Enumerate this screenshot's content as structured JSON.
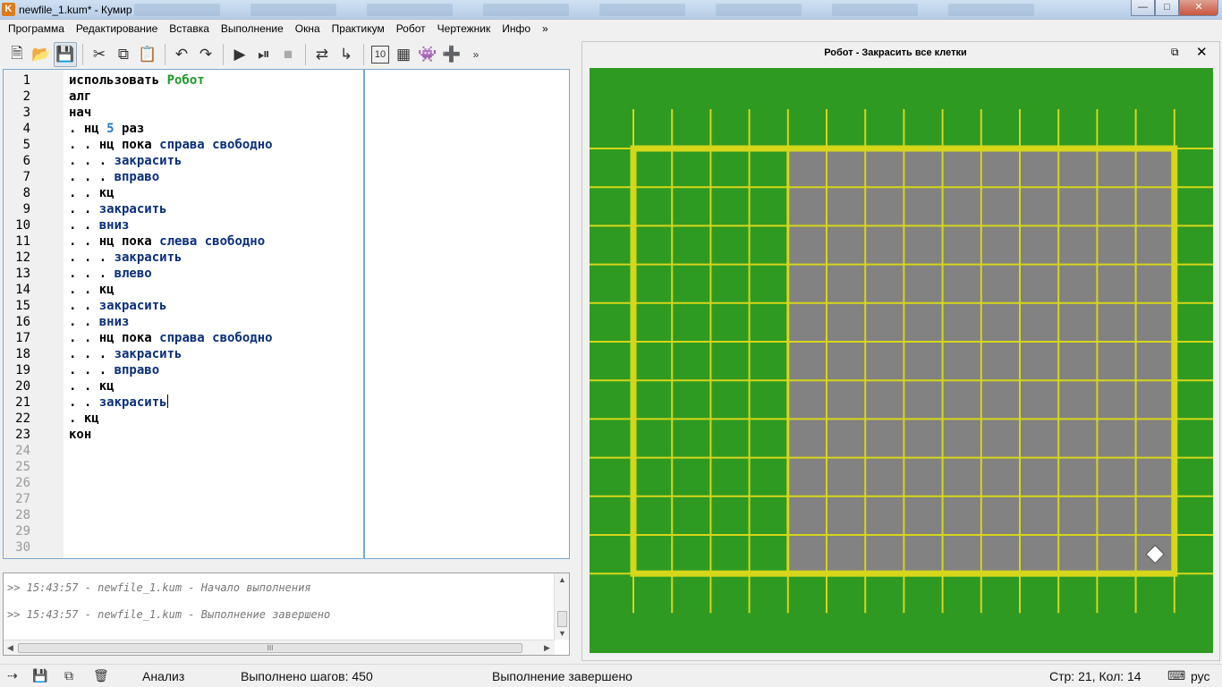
{
  "window": {
    "title": "newfile_1.kum* - Кумир",
    "app_icon_letter": "K"
  },
  "menu": [
    "Программа",
    "Редактирование",
    "Вставка",
    "Выполнение",
    "Окна",
    "Практикум",
    "Робот",
    "Чертежник",
    "Инфо",
    "»"
  ],
  "toolbar": {
    "icons": [
      "new-file-icon",
      "open-file-icon",
      "save-file-icon",
      "cut-icon",
      "copy-icon",
      "paste-icon",
      "undo-icon",
      "redo-icon",
      "run-icon",
      "run-steps-icon",
      "stop-icon",
      "step-over-icon",
      "step-into-icon",
      "counter-icon",
      "grid-icon",
      "robot-game-icon",
      "green-grid-icon"
    ],
    "overflow": "»"
  },
  "editor": {
    "line_numbers": [
      "1",
      "2",
      "3",
      "4",
      "5",
      "6",
      "7",
      "8",
      "9",
      "10",
      "11",
      "12",
      "13",
      "14",
      "15",
      "16",
      "17",
      "18",
      "19",
      "20",
      "21",
      "22",
      "23",
      "24",
      "25",
      "26",
      "27",
      "28",
      "29",
      "30"
    ],
    "lines": [
      [
        {
          "t": "использовать ",
          "c": "kw"
        },
        {
          "t": "Робот",
          "c": "gn"
        }
      ],
      [
        {
          "t": "алг",
          "c": "kw"
        }
      ],
      [
        {
          "t": "нач",
          "c": "kw"
        }
      ],
      [
        {
          "t": ". нц ",
          "c": "kw"
        },
        {
          "t": "5",
          "c": "nm"
        },
        {
          "t": " раз",
          "c": "kw"
        }
      ],
      [
        {
          "t": ". . нц пока ",
          "c": "kw"
        },
        {
          "t": "справа свободно",
          "c": "ac"
        }
      ],
      [
        {
          "t": ". . . ",
          "c": "kw"
        },
        {
          "t": "закрасить",
          "c": "ac"
        }
      ],
      [
        {
          "t": ". . . ",
          "c": "kw"
        },
        {
          "t": "вправо",
          "c": "ac"
        }
      ],
      [
        {
          "t": ". . кц",
          "c": "kw"
        }
      ],
      [
        {
          "t": ". . ",
          "c": "kw"
        },
        {
          "t": "закрасить",
          "c": "ac"
        }
      ],
      [
        {
          "t": ". . ",
          "c": "kw"
        },
        {
          "t": "вниз",
          "c": "ac"
        }
      ],
      [
        {
          "t": ". . нц пока ",
          "c": "kw"
        },
        {
          "t": "слева свободно",
          "c": "ac"
        }
      ],
      [
        {
          "t": ". . . ",
          "c": "kw"
        },
        {
          "t": "закрасить",
          "c": "ac"
        }
      ],
      [
        {
          "t": ". . . ",
          "c": "kw"
        },
        {
          "t": "влево",
          "c": "ac"
        }
      ],
      [
        {
          "t": ". . кц",
          "c": "kw"
        }
      ],
      [
        {
          "t": ". . ",
          "c": "kw"
        },
        {
          "t": "закрасить",
          "c": "ac"
        }
      ],
      [
        {
          "t": ". . ",
          "c": "kw"
        },
        {
          "t": "вниз",
          "c": "ac"
        }
      ],
      [
        {
          "t": ". . нц пока ",
          "c": "kw"
        },
        {
          "t": "справа свободно",
          "c": "ac"
        }
      ],
      [
        {
          "t": ". . . ",
          "c": "kw"
        },
        {
          "t": "закрасить",
          "c": "ac"
        }
      ],
      [
        {
          "t": ". . . ",
          "c": "kw"
        },
        {
          "t": "вправо",
          "c": "ac"
        }
      ],
      [
        {
          "t": ". . кц",
          "c": "kw"
        }
      ],
      [
        {
          "t": ". . ",
          "c": "kw"
        },
        {
          "t": "закрасить",
          "c": "ac"
        }
      ],
      [
        {
          "t": ". кц",
          "c": "kw"
        }
      ],
      [
        {
          "t": "кон",
          "c": "kw"
        }
      ]
    ]
  },
  "console": {
    "messages": [
      ">> 15:43:57 - newfile_1.kum - Начало выполнения",
      ">> 15:43:57 - newfile_1.kum - Выполнение завершено"
    ],
    "scroll_grip": "III"
  },
  "robot": {
    "title": "Робот  - Закрасить все клетки",
    "field_cols": 14,
    "field_rows": 11,
    "painted_from_col": 4,
    "robot_cell": [
      13,
      10
    ],
    "colors": {
      "field": "#2e9a22",
      "grid": "#d6d61a",
      "painted": "#828282",
      "robot": "#ffffff"
    }
  },
  "status": {
    "analysis": "Анализ",
    "steps": "Выполнено шагов: 450",
    "state": "Выполнение завершено",
    "position": "Стр: 21, Кол: 14",
    "lang": "рус"
  }
}
